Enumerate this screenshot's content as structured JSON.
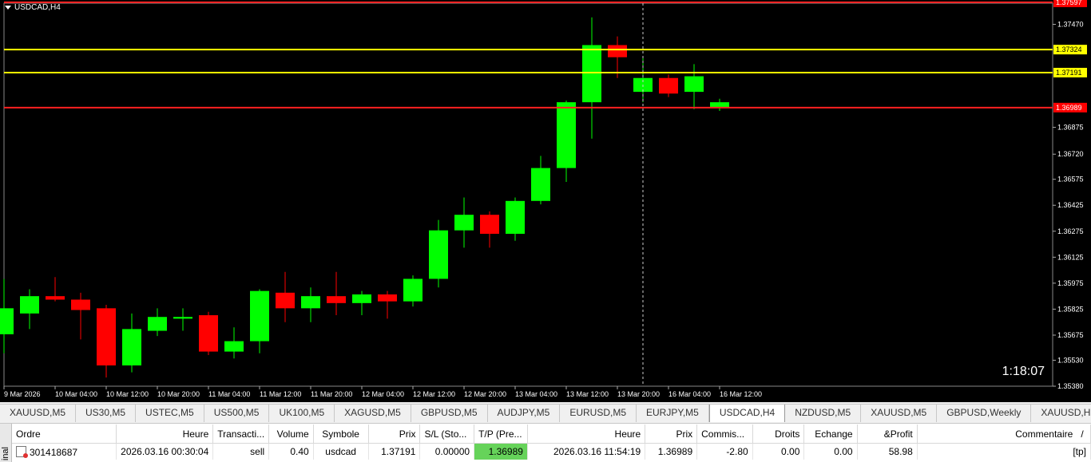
{
  "chart": {
    "symbol_label": "USDCAD,H4",
    "time_remaining": "1:18:07",
    "price_range": [
      1.3538,
      1.37592
    ],
    "price_ticks": [
      "1.37470",
      "1.36875",
      "1.36720",
      "1.36575",
      "1.36425",
      "1.36275",
      "1.36125",
      "1.35975",
      "1.35825",
      "1.35675",
      "1.35530",
      "1.35380"
    ],
    "time_labels": [
      "9 Mar 2026",
      "10 Mar 04:00",
      "10 Mar 12:00",
      "10 Mar 20:00",
      "11 Mar 04:00",
      "11 Mar 12:00",
      "11 Mar 20:00",
      "12 Mar 04:00",
      "12 Mar 12:00",
      "12 Mar 20:00",
      "13 Mar 04:00",
      "13 Mar 12:00",
      "13 Mar 20:00",
      "16 Mar 04:00",
      "16 Mar 12:00"
    ],
    "levels": [
      {
        "label": "1.37597",
        "price": 1.37597,
        "color": "#ff2020",
        "tag_bg": "#ff0000",
        "tag_fg": "#ffffff"
      },
      {
        "label": "1.37324",
        "price": 1.37324,
        "color": "#ffff00",
        "tag_bg": "#ffff00",
        "tag_fg": "#000000"
      },
      {
        "label": "1.37191",
        "price": 1.37191,
        "color": "#ffff00",
        "tag_bg": "#ffff00",
        "tag_fg": "#000000"
      },
      {
        "label": "1.36989",
        "price": 1.36989,
        "color": "#ff2020",
        "tag_bg": "#ff0000",
        "tag_fg": "#ffffff"
      }
    ],
    "up_color": "#00ff00",
    "down_color": "#ff0000",
    "candles": [
      {
        "o": 1.3568,
        "h": 1.36,
        "l": 1.3557,
        "c": 1.3583
      },
      {
        "o": 1.358,
        "h": 1.3594,
        "l": 1.3571,
        "c": 1.359
      },
      {
        "o": 1.359,
        "h": 1.3601,
        "l": 1.3587,
        "c": 1.3588
      },
      {
        "o": 1.3588,
        "h": 1.3592,
        "l": 1.3565,
        "c": 1.3582
      },
      {
        "o": 1.3583,
        "h": 1.3585,
        "l": 1.3543,
        "c": 1.355
      },
      {
        "o": 1.355,
        "h": 1.358,
        "l": 1.3546,
        "c": 1.3571
      },
      {
        "o": 1.357,
        "h": 1.3583,
        "l": 1.3567,
        "c": 1.3578
      },
      {
        "o": 1.3577,
        "h": 1.3583,
        "l": 1.357,
        "c": 1.3578
      },
      {
        "o": 1.3579,
        "h": 1.3581,
        "l": 1.3556,
        "c": 1.3558
      },
      {
        "o": 1.3558,
        "h": 1.3572,
        "l": 1.3554,
        "c": 1.3564
      },
      {
        "o": 1.3564,
        "h": 1.3594,
        "l": 1.3557,
        "c": 1.3593
      },
      {
        "o": 1.3592,
        "h": 1.3604,
        "l": 1.3575,
        "c": 1.3583
      },
      {
        "o": 1.3583,
        "h": 1.3595,
        "l": 1.3575,
        "c": 1.359
      },
      {
        "o": 1.359,
        "h": 1.3604,
        "l": 1.3579,
        "c": 1.3586
      },
      {
        "o": 1.3586,
        "h": 1.3593,
        "l": 1.3579,
        "c": 1.3591
      },
      {
        "o": 1.3591,
        "h": 1.3593,
        "l": 1.3577,
        "c": 1.3587
      },
      {
        "o": 1.3587,
        "h": 1.3602,
        "l": 1.3584,
        "c": 1.36
      },
      {
        "o": 1.36,
        "h": 1.3634,
        "l": 1.3595,
        "c": 1.3628
      },
      {
        "o": 1.3628,
        "h": 1.3647,
        "l": 1.3618,
        "c": 1.3637
      },
      {
        "o": 1.3637,
        "h": 1.3639,
        "l": 1.3618,
        "c": 1.3626
      },
      {
        "o": 1.3626,
        "h": 1.3647,
        "l": 1.3622,
        "c": 1.3645
      },
      {
        "o": 1.3645,
        "h": 1.3671,
        "l": 1.3643,
        "c": 1.3664
      },
      {
        "o": 1.3664,
        "h": 1.3703,
        "l": 1.3656,
        "c": 1.3702
      },
      {
        "o": 1.3702,
        "h": 1.3751,
        "l": 1.3681,
        "c": 1.3735
      },
      {
        "o": 1.3735,
        "h": 1.374,
        "l": 1.3716,
        "c": 1.3728
      },
      {
        "o": 1.3708,
        "h": 1.3728,
        "l": 1.3702,
        "c": 1.3716
      },
      {
        "o": 1.3716,
        "h": 1.3718,
        "l": 1.3705,
        "c": 1.3707
      },
      {
        "o": 1.3708,
        "h": 1.3724,
        "l": 1.3698,
        "c": 1.3717
      },
      {
        "o": 1.3699,
        "h": 1.3704,
        "l": 1.3697,
        "c": 1.3702
      }
    ]
  },
  "tabs": [
    "XAUUSD,M5",
    "US30,M5",
    "USTEC,M5",
    "US500,M5",
    "UK100,M5",
    "XAGUSD,M5",
    "GBPUSD,M5",
    "AUDJPY,M5",
    "EURUSD,M5",
    "EURJPY,M5",
    "USDCAD,H4",
    "NZDUSD,M5",
    "XAUUSD,M5",
    "GBPUSD,Weekly",
    "XAUUSD,H1",
    "XAUUSD,"
  ],
  "active_tab": "USDCAD,H4",
  "terminal": {
    "side_label": "inal",
    "headers": [
      "Ordre",
      "Heure",
      "Transacti...",
      "Volume",
      "Symbole",
      "Prix",
      "S/L (Sto...",
      "T/P (Pre...",
      "Heure",
      "Prix",
      "Commis...",
      "Droits",
      "Echange",
      "&Profit",
      "Commentaire"
    ],
    "sort_marker": "/",
    "row": {
      "ordre": "301418687",
      "heure": "2026.03.16 00:30:04",
      "transaction": "sell",
      "volume": "0.40",
      "symbole": "usdcad",
      "prix": "1.37191",
      "sl": "0.00000",
      "tp": "1.36989",
      "heure2": "2026.03.16 11:54:19",
      "prix2": "1.36989",
      "commission": "-2.80",
      "droits": "0.00",
      "echange": "0.00",
      "profit": "58.98",
      "commentaire": "[tp]"
    }
  }
}
